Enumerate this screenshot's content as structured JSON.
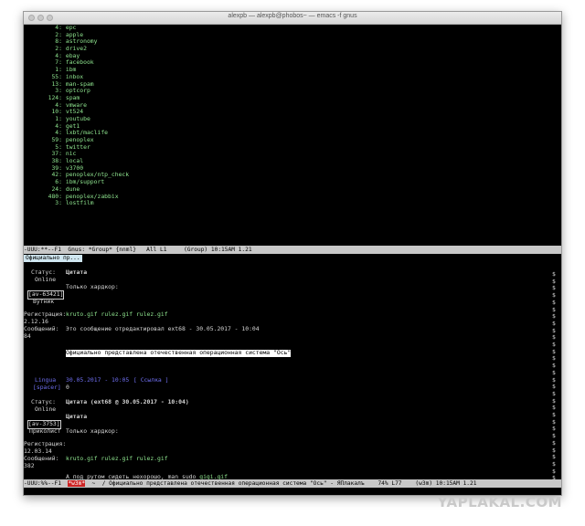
{
  "window": {
    "title": "alexpb — alexpb@phobos~ — emacs -f gnus"
  },
  "groups": [
    {
      "count": "4:",
      "name": "epc"
    },
    {
      "count": "2:",
      "name": "apple"
    },
    {
      "count": "8:",
      "name": "astronomy"
    },
    {
      "count": "2:",
      "name": "drive2"
    },
    {
      "count": "4:",
      "name": "ebay"
    },
    {
      "count": "7:",
      "name": "facebook"
    },
    {
      "count": "1:",
      "name": "ibm"
    },
    {
      "count": "55:",
      "name": "inbox"
    },
    {
      "count": "13:",
      "name": "man-spam"
    },
    {
      "count": "3:",
      "name": "optcorp"
    },
    {
      "count": "124:",
      "name": "spam"
    },
    {
      "count": "4:",
      "name": "vmware"
    },
    {
      "count": "10:",
      "name": "vt524"
    },
    {
      "count": "1:",
      "name": "youtube"
    },
    {
      "count": "4:",
      "name": "get1"
    },
    {
      "count": "4:",
      "name": "lxbt/maclife"
    },
    {
      "count": "59:",
      "name": "penoplex"
    },
    {
      "count": "5:",
      "name": "twitter"
    },
    {
      "count": "37:",
      "name": "nic"
    },
    {
      "count": "38:",
      "name": "local"
    },
    {
      "count": "39:",
      "name": "v3700"
    },
    {
      "count": "42:",
      "name": "penoplex/ntp_check"
    },
    {
      "count": "6:",
      "name": "ibm/support"
    },
    {
      "count": "24:",
      "name": "dune"
    },
    {
      "count": "480:",
      "name": "penoplex/zabbix"
    },
    {
      "count": "3:",
      "name": "lostfilm"
    }
  ],
  "modeline1": "-UUU:**--F1  Gnus: *Group* {nnml}   All L1     (Group) 10:15AM 1.21 ",
  "minibuffer": "Официально пр...",
  "article": {
    "p1": {
      "status_label": "Статус:",
      "status_value": "Online",
      "avatar": "[av-63421]",
      "rank": "Вутник",
      "quote_label": "Цитата",
      "quote_text": "Только хардкор:",
      "reg_label": "Регистрация:",
      "reg_date": "2.12.16",
      "msgs_label": "Сообщений:",
      "msgs_count": "84",
      "gifs": "kruto.gif rulez.gif rulez.gif",
      "edited": "Это сообщение отредактировал ext68 - 30.05.2017 - 10:04",
      "highlight": "Официально представлена отечественная операционная система \"Ось\""
    },
    "p2": {
      "author": "Lingua",
      "date": "30.05.2017 - 10:05",
      "link": "[ Ссылка ]",
      "spacer": "[spacer]",
      "num": "0",
      "status_label": "Статус:",
      "status_value": "Online",
      "quote_header": "Цитата (ext68 @ 30.05.2017 - 10:04)",
      "quote_label": "Цитата",
      "quote_text": "Только хардкор:",
      "avatar": "[av-3753]",
      "rank": "Приколист",
      "reg_label": "Регистрация:",
      "reg_date": "12.03.14",
      "msgs_label": "Сообщений:",
      "msgs_count": "382",
      "gifs": "kruto.gif rulez.gif rulez.gif",
      "reply_prefix": "А под рутом сидеть нехорошо, man sudo ",
      "reply_gif": "gigi.gif"
    }
  },
  "modeline2": {
    "left": "-UUU:%%--F1  ",
    "badge": "*w3m*",
    "rest": "  ~  / Официально представлена отечественная операционная система \"Ось\" - ЯПлакалъ    74% L77    (w3m) 10:15AM 1.21 "
  },
  "watermark": "YAPLAKAL.COM"
}
